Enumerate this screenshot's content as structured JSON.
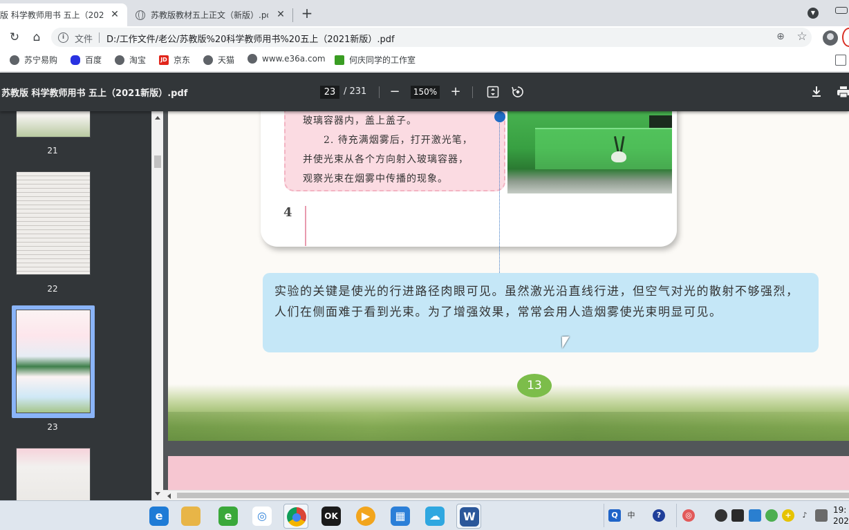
{
  "browser": {
    "tabs": [
      {
        "title": "版 科学教师用书 五上（202",
        "active": true
      },
      {
        "title": "苏教版教材五上正文（新版）.pd",
        "active": false
      }
    ],
    "tab_close_glyph": "✕",
    "new_tab_glyph": "+",
    "address": {
      "security_label": "文件",
      "url": "D:/工作文件/老公/苏教版%20科学教师用书%20五上（2021新版）.pdf"
    },
    "bookmarks": [
      {
        "label": "苏宁易购",
        "icon": "globe-icon"
      },
      {
        "label": "百度",
        "icon": "baidu-paw-icon"
      },
      {
        "label": "淘宝",
        "icon": "globe-icon"
      },
      {
        "label": "京东",
        "icon": "jd-icon",
        "badge": "JD"
      },
      {
        "label": "天猫",
        "icon": "globe-icon"
      },
      {
        "label": "www.e36a.com",
        "icon": "globe-icon"
      },
      {
        "label": "何庆同学的工作室",
        "icon": "leaf-icon"
      }
    ]
  },
  "pdf_viewer": {
    "title": "苏教版 科学教师用书 五上（2021新版）.pdf",
    "current_page": "23",
    "total_pages": "/ 231",
    "zoom": "150%",
    "zoom_out_glyph": "−",
    "zoom_in_glyph": "+",
    "thumbnails": [
      {
        "label": "21"
      },
      {
        "label": "22"
      },
      {
        "label": "23",
        "selected": true
      },
      {
        "label": ""
      }
    ]
  },
  "page_content": {
    "pink_note_lines": [
      "玻璃容器内，盖上盖子。",
      "　　2. 待充满烟雾后，打开激光笔，",
      "并使光束从各个方向射入玻璃容器，",
      "观察光束在烟雾中传播的现象。"
    ],
    "step_number": "4",
    "blue_note": "实验的关键是使光的行进路径肉眼可见。虽然激光沿直线行进，但空气对光的散射不够强烈，人们在侧面难于看到光束。为了增强效果，常常会用人造烟雾使光束明显可见。",
    "page_number": "13"
  },
  "taskbar": {
    "apps": [
      {
        "name": "ie-icon",
        "color": "#1e7bd6",
        "glyph": "e"
      },
      {
        "name": "file-explorer-icon",
        "color": "#e8b547",
        "glyph": ""
      },
      {
        "name": "browser-green-icon",
        "color": "#3aa83a",
        "glyph": "e"
      },
      {
        "name": "baidu-netdisk-icon",
        "color": "#ffffff",
        "glyph": "◎"
      },
      {
        "name": "chrome-icon",
        "color": "#db4437",
        "glyph": "●",
        "active": true
      },
      {
        "name": "video-recorder-icon",
        "color": "#1a1a1a",
        "glyph": "OK"
      },
      {
        "name": "media-player-icon",
        "color": "#f2a51d",
        "glyph": "▶"
      },
      {
        "name": "tiles-app-icon",
        "color": "#2b7fd8",
        "glyph": "▦"
      },
      {
        "name": "cloud-app-icon",
        "color": "#2fa7e0",
        "glyph": "☁"
      },
      {
        "name": "word-icon",
        "color": "#2b579a",
        "glyph": "W",
        "active": true
      }
    ],
    "tray": {
      "ime_label": "中",
      "clock_time": "19:",
      "clock_date": "202"
    }
  }
}
